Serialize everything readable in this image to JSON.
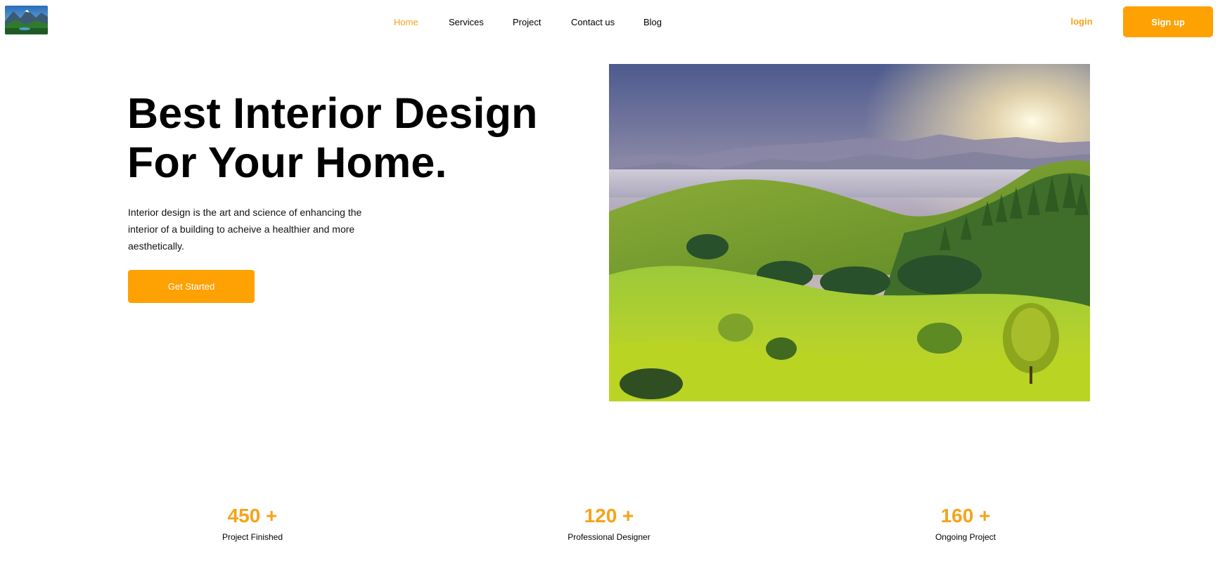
{
  "header": {
    "logo_icon": "landscape-thumbnail-logo",
    "nav": [
      {
        "label": "Home",
        "active": true
      },
      {
        "label": "Services",
        "active": false
      },
      {
        "label": "Project",
        "active": false
      },
      {
        "label": "Contact us",
        "active": false
      },
      {
        "label": "Blog",
        "active": false
      }
    ],
    "login_label": "login",
    "signup_label": "Sign up"
  },
  "hero": {
    "title_line1": "Best Interior Design",
    "title_line2": "For Your Home.",
    "description": "Interior design is the art and science of enhancing the interior of a building to acheive a healthier and more aesthetically.",
    "cta_label": "Get Started",
    "image_icon": "mountain-landscape-photo"
  },
  "stats": [
    {
      "value": "450 +",
      "label": "Project Finished"
    },
    {
      "value": "120 +",
      "label": "Professional Designer"
    },
    {
      "value": "160 +",
      "label": "Ongoing Project"
    }
  ],
  "colors": {
    "accent": "#fea103",
    "accent_text": "#f6a31a",
    "text": "#000000",
    "background": "#ffffff"
  }
}
